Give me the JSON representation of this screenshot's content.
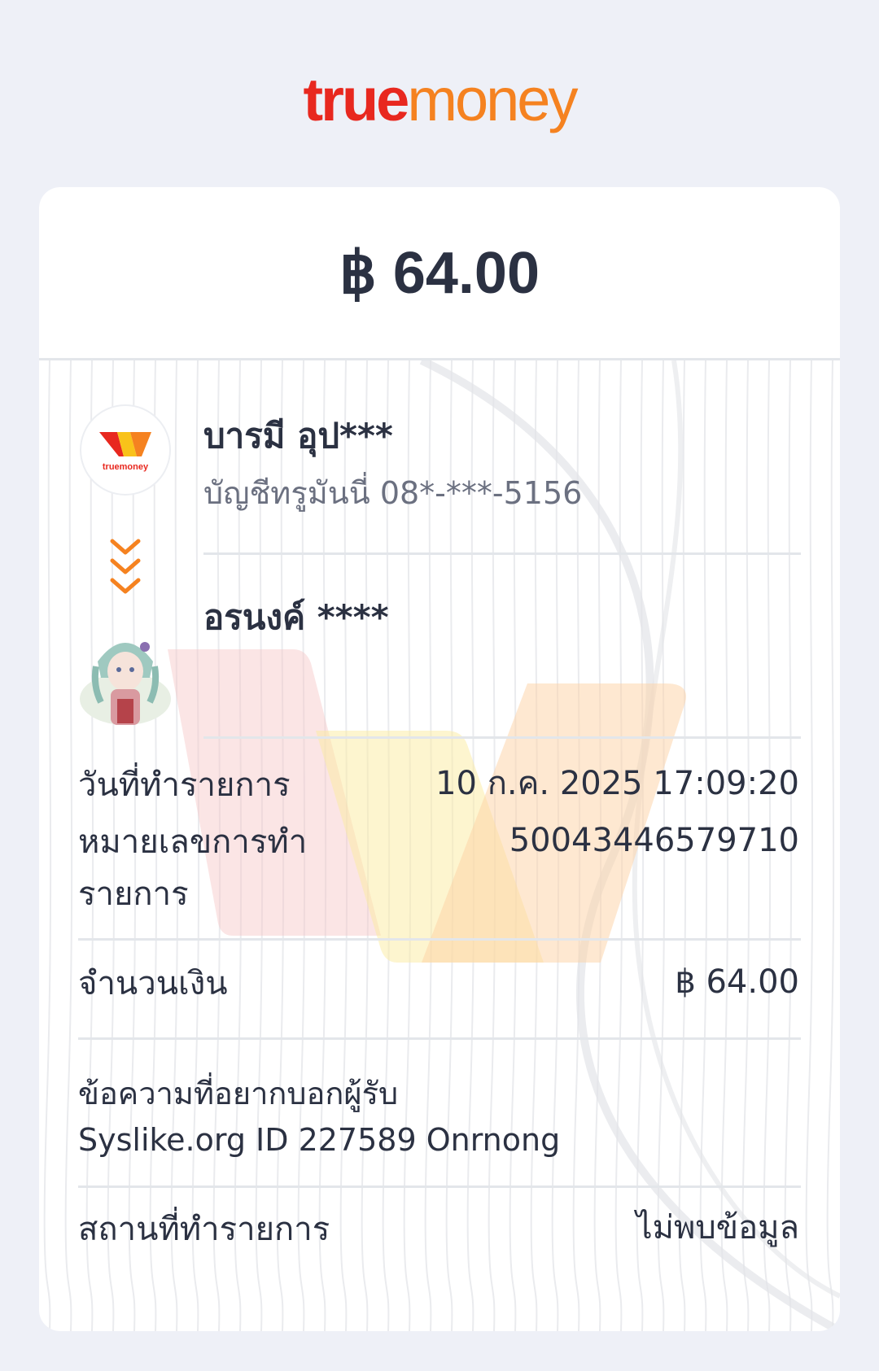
{
  "brand": {
    "logo_part1": "true",
    "logo_part2": "money"
  },
  "amount": "฿ 64.00",
  "sender": {
    "name": "บารมี อุป***",
    "account": "บัญชีทรูมันนี่ 08*-***-5156",
    "avatar_logo_text": "truemoney"
  },
  "receiver": {
    "name": "อรนงค์ ****"
  },
  "details": {
    "date_label": "วันที่ทำรายการ",
    "date_value": "10 ก.ค. 2025 17:09:20",
    "txn_label_line1": "หมายเลขการทำ",
    "txn_label_line2": "รายการ",
    "txn_value": "50043446579710",
    "amount_label": "จำนวนเงิน",
    "amount_value": "฿ 64.00",
    "message_label": "ข้อความที่อยากบอกผู้รับ",
    "message_value": "Syslike.org ID 227589 Onrnong",
    "location_label": "สถานที่ทำรายการ",
    "location_value": "ไม่พบข้อมูล"
  },
  "colors": {
    "brand_red": "#e8281f",
    "brand_orange": "#f58220",
    "text": "#2b3142",
    "muted": "#6b7080",
    "bg": "#eef0f7"
  }
}
